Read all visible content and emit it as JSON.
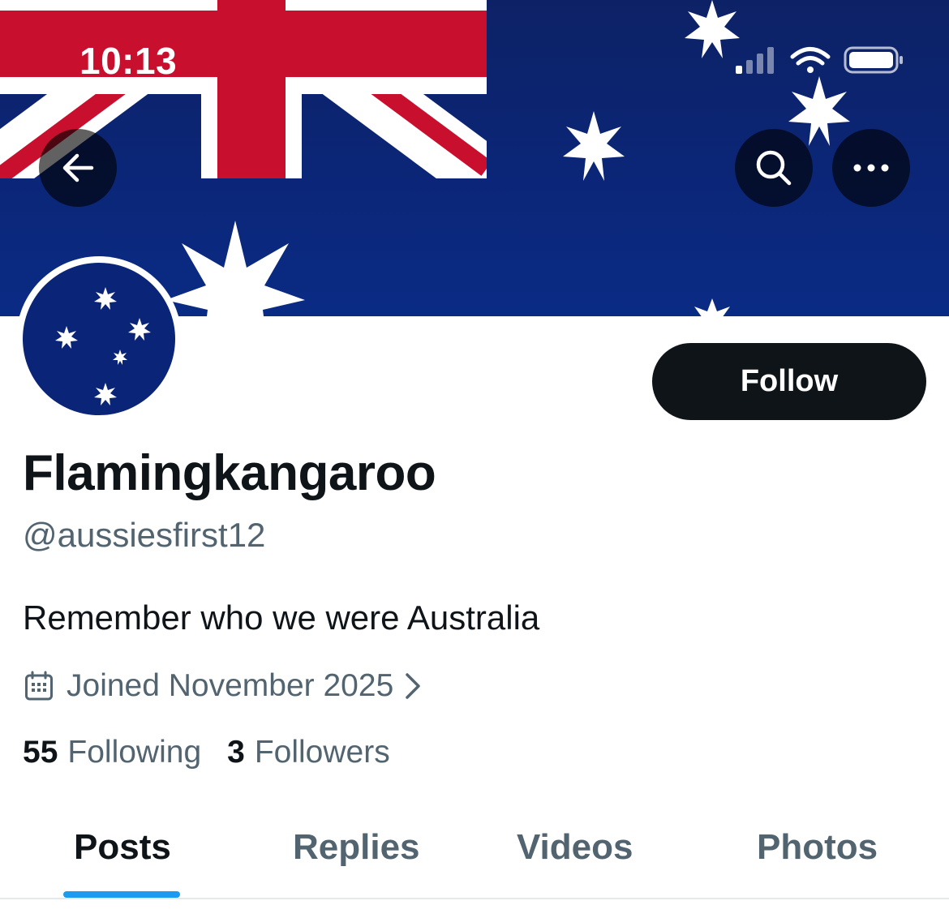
{
  "status_bar": {
    "time": "10:13",
    "icons": [
      "cellular-signal-icon",
      "wifi-icon",
      "battery-icon"
    ]
  },
  "header": {
    "back_icon": "arrow-left-icon",
    "search_icon": "search-icon",
    "more_icon": "more-horizontal-icon"
  },
  "profile": {
    "display_name": "Flamingkangaroo",
    "handle": "@aussiesfirst12",
    "bio": "Remember who we were Australia",
    "joined": "Joined November 2025",
    "follow_label": "Follow"
  },
  "stats": {
    "following_count": "55",
    "following_label": "Following",
    "followers_count": "3",
    "followers_label": "Followers"
  },
  "tabs": [
    {
      "label": "Posts",
      "active": true
    },
    {
      "label": "Replies",
      "active": false
    },
    {
      "label": "Videos",
      "active": false
    },
    {
      "label": "Photos",
      "active": false
    }
  ],
  "colors": {
    "accent": "#1d9bf0",
    "text_primary": "#0f1419",
    "text_secondary": "#536471",
    "flag_blue": "#0a2577",
    "flag_red": "#c8102e"
  }
}
